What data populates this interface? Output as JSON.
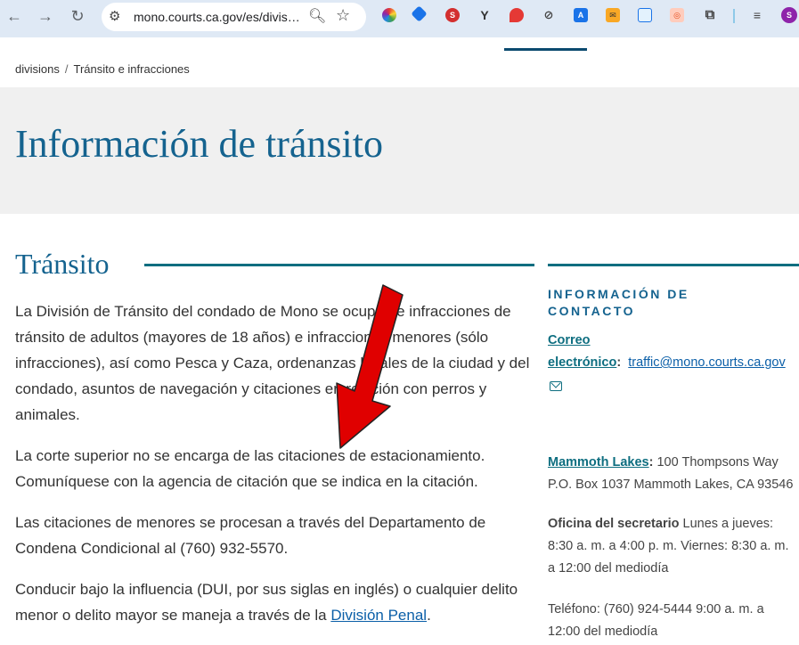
{
  "browser": {
    "url": "mono.courts.ca.gov/es/divis…",
    "back_icon": "←",
    "forward_icon": "→",
    "reload_icon": "↻",
    "profile_initial": "S",
    "extensions": [
      "color-wheel-ext",
      "tag-ext",
      "seo-ext",
      "y-ext",
      "location-ext",
      "eye-off-ext",
      "translate-ext",
      "mail-ext",
      "window-ext",
      "shot-ext",
      "puzzle-icon",
      "media-icon"
    ]
  },
  "breadcrumb": {
    "items": [
      "divisions",
      "Tránsito e infracciones"
    ],
    "separator": "/"
  },
  "hero": {
    "title": "Información de tránsito"
  },
  "main": {
    "section_title": "Tránsito",
    "paragraph1": "La División de Tránsito del condado de Mono se ocupa de infracciones de tránsito de adultos (mayores de 18 años) e infracciones menores (sólo infracciones), así como  Pesca y Caza, ordenanzas locales de la ciudad y del condado, asuntos de navegación y citaciones en relación con perros y animales.",
    "paragraph2": "La corte superior no se encarga de las citaciones de estacionamiento. Comuníquese con la agencia de citación que se indica en la citación.",
    "paragraph3": "Las citaciones de menores se procesan a través del Departamento de Condena Condicional al (760) 932-5570.",
    "paragraph4_before": "Conducir bajo la influencia (DUI, por sus siglas en inglés) o cualquier delito menor o delito mayor se maneja a través de la ",
    "paragraph4_link": "División Penal",
    "paragraph4_after": "."
  },
  "sidebar": {
    "contact_title": "INFORMACIÓN DE CONTACTO",
    "email_label_1": "Correo",
    "email_label_2": "electrónico",
    "email_colon": ":",
    "email": "traffic@mono.courts.ca.gov",
    "location_label": "Mammoth Lakes",
    "location_colon": ":",
    "address_line1": " 100 Thompsons Way",
    "address_line2": "P.O. Box 1037 Mammoth Lakes, CA 93546",
    "clerk_label": "Oficina del secretario",
    "clerk_hours": " Lunes a jueves: 8:30 a. m. a 4:00 p. m. Viernes: 8:30 a. m. a 12:00 del mediodía",
    "phone": "Teléfono: (760) 924-5444 9:00 a. m. a 12:00 del mediodía"
  },
  "colors": {
    "heading_blue": "#15638f",
    "rule_teal": "#0e6e80",
    "hero_bg": "#f0f0f0",
    "arrow_red": "#e00000"
  }
}
